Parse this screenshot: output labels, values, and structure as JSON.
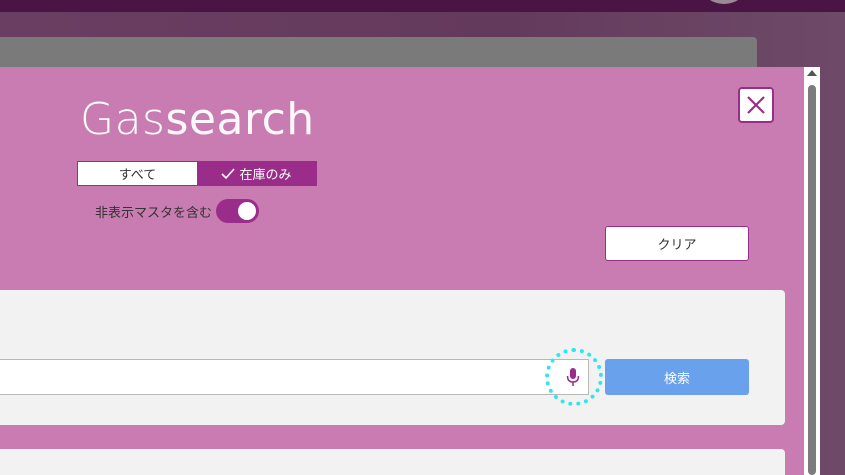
{
  "header": {
    "logo_bold": "Gas",
    "logo_light": "search"
  },
  "filter": {
    "all_label": "すべて",
    "stock_label": "在庫のみ",
    "selected": "在庫のみ",
    "hidden_master_label": "非表示マスタを含む",
    "hidden_master_on": true
  },
  "buttons": {
    "clear_label": "クリア",
    "search_label": "検索"
  },
  "search": {
    "value": "",
    "placeholder": ""
  },
  "icons": {
    "close": "close-icon",
    "check": "check-icon",
    "mic": "microphone-icon"
  },
  "colors": {
    "accent": "#9b2d8a",
    "panel": "#c97cb1",
    "search_button": "#6aa1ec",
    "highlight": "#2ee6ee"
  }
}
